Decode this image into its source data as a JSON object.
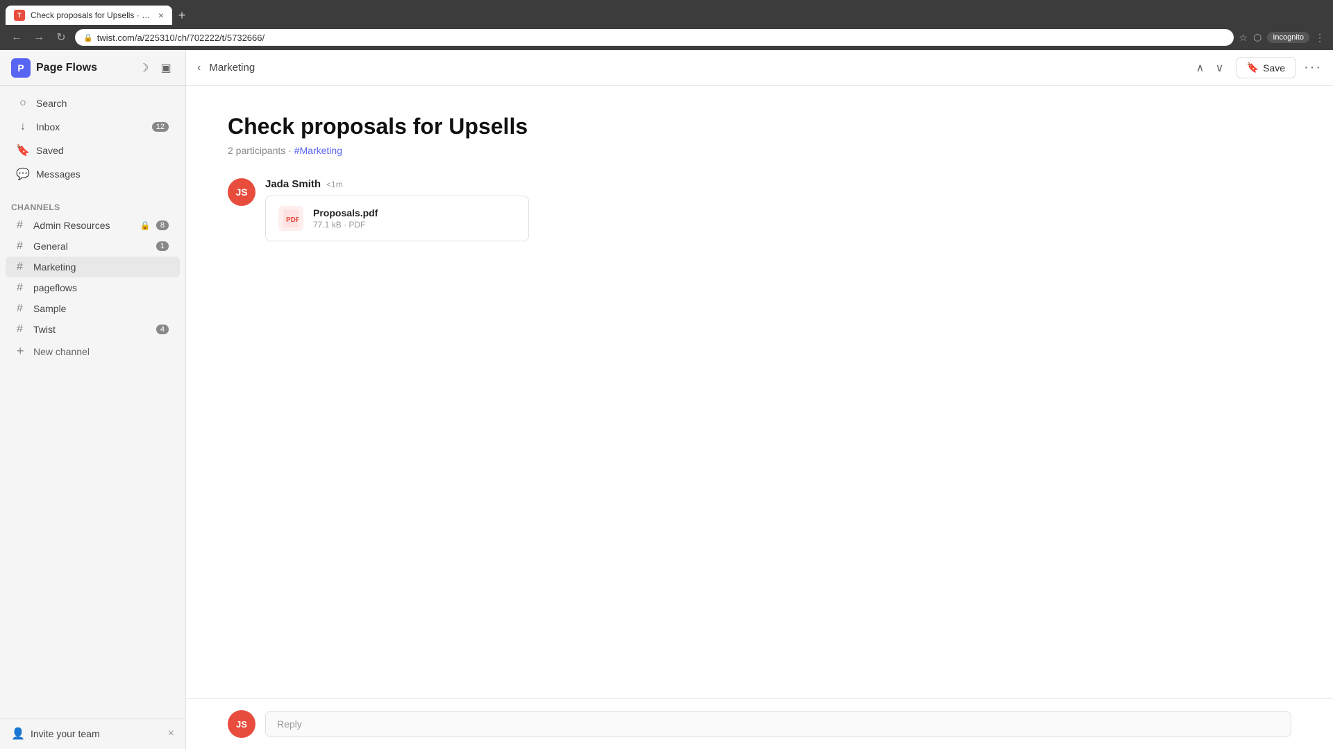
{
  "browser": {
    "tab_title": "Check proposals for Upsells · Pa...",
    "tab_favicon": "T",
    "url": "twist.com/a/225310/ch/702222/t/5732666/",
    "new_tab_label": "+",
    "incognito_label": "Incognito"
  },
  "sidebar": {
    "logo_letter": "P",
    "app_name": "Page Flows",
    "nav_items": [
      {
        "id": "search",
        "label": "Search",
        "icon": "🔍",
        "badge": null
      },
      {
        "id": "inbox",
        "label": "Inbox",
        "icon": "📥",
        "badge": "12"
      },
      {
        "id": "saved",
        "label": "Saved",
        "icon": "🔖",
        "badge": null
      },
      {
        "id": "messages",
        "label": "Messages",
        "icon": "💬",
        "badge": null
      }
    ],
    "channels_header": "Channels",
    "channels": [
      {
        "id": "admin-resources",
        "name": "Admin Resources",
        "locked": true,
        "badge": "8"
      },
      {
        "id": "general",
        "name": "General",
        "locked": false,
        "badge": "1"
      },
      {
        "id": "marketing",
        "name": "Marketing",
        "locked": false,
        "badge": null,
        "active": true
      },
      {
        "id": "pageflows",
        "name": "pageflows",
        "locked": false,
        "badge": null
      },
      {
        "id": "sample",
        "name": "Sample",
        "locked": false,
        "badge": null
      },
      {
        "id": "twist",
        "name": "Twist",
        "locked": false,
        "badge": "4"
      }
    ],
    "new_channel_label": "New channel",
    "invite_team_label": "Invite your team"
  },
  "header": {
    "breadcrumb": "Marketing",
    "save_label": "Save",
    "bookmark_icon": "🔖",
    "more_icon": "···"
  },
  "thread": {
    "title": "Check proposals for Upsells",
    "participants": "2 participants",
    "channel_tag": "#Marketing",
    "messages": [
      {
        "id": "msg1",
        "author": "Jada Smith",
        "time": "<1m",
        "avatar_initials": "JS",
        "attachment": {
          "name": "Proposals.pdf",
          "size": "77.1 kB",
          "type": "PDF",
          "icon": "📄"
        }
      }
    ]
  },
  "reply_bar": {
    "placeholder": "Reply",
    "avatar_initials": "JS"
  },
  "icons": {
    "search": "○",
    "moon": "☽",
    "layout": "▣",
    "back": "‹",
    "up": "∧",
    "down": "∨",
    "lock": "🔒",
    "plus": "+",
    "close": "×",
    "invite": "👤"
  }
}
